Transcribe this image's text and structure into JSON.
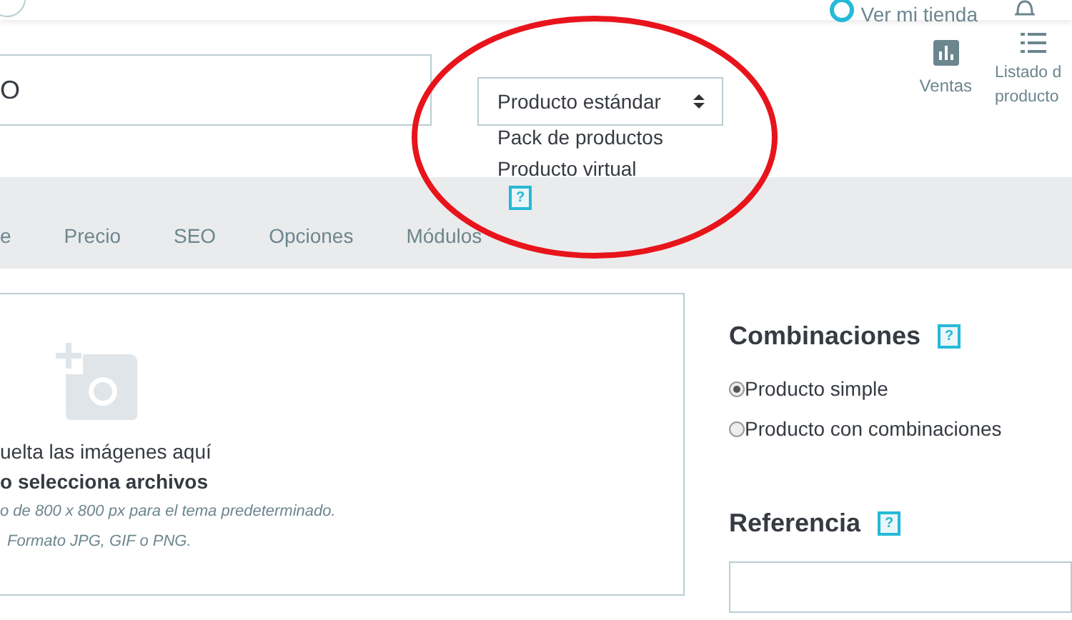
{
  "topbar": {
    "shop_link": "Ver mi tienda"
  },
  "header": {
    "name_value": "O",
    "type_select": {
      "value": "Producto estándar",
      "options": [
        "Pack de productos",
        "Producto virtual"
      ],
      "help": "?"
    },
    "actions": [
      {
        "label_lines": [
          "Ventas"
        ],
        "kind": "chart"
      },
      {
        "label_lines": [
          "Listado d",
          "producto"
        ],
        "kind": "list"
      }
    ]
  },
  "tabs": [
    {
      "label": "e",
      "selected": false
    },
    {
      "label": "Precio",
      "selected": false
    },
    {
      "label": "SEO",
      "selected": false
    },
    {
      "label": "Opciones",
      "selected": false
    },
    {
      "label": "Módulos",
      "selected": false
    }
  ],
  "dropzone": {
    "lines": [
      "uelta las imágenes aquí",
      "o selecciona archivos",
      "o de 800 x 800 px para el tema predeterminado.",
      "Formato JPG, GIF o PNG."
    ]
  },
  "combinations": {
    "title": "Combinaciones",
    "help": "?",
    "options": [
      {
        "label": "Producto simple",
        "selected": true
      },
      {
        "label": "Producto con combinaciones",
        "selected": false
      }
    ]
  },
  "reference": {
    "title": "Referencia",
    "help": "?"
  }
}
